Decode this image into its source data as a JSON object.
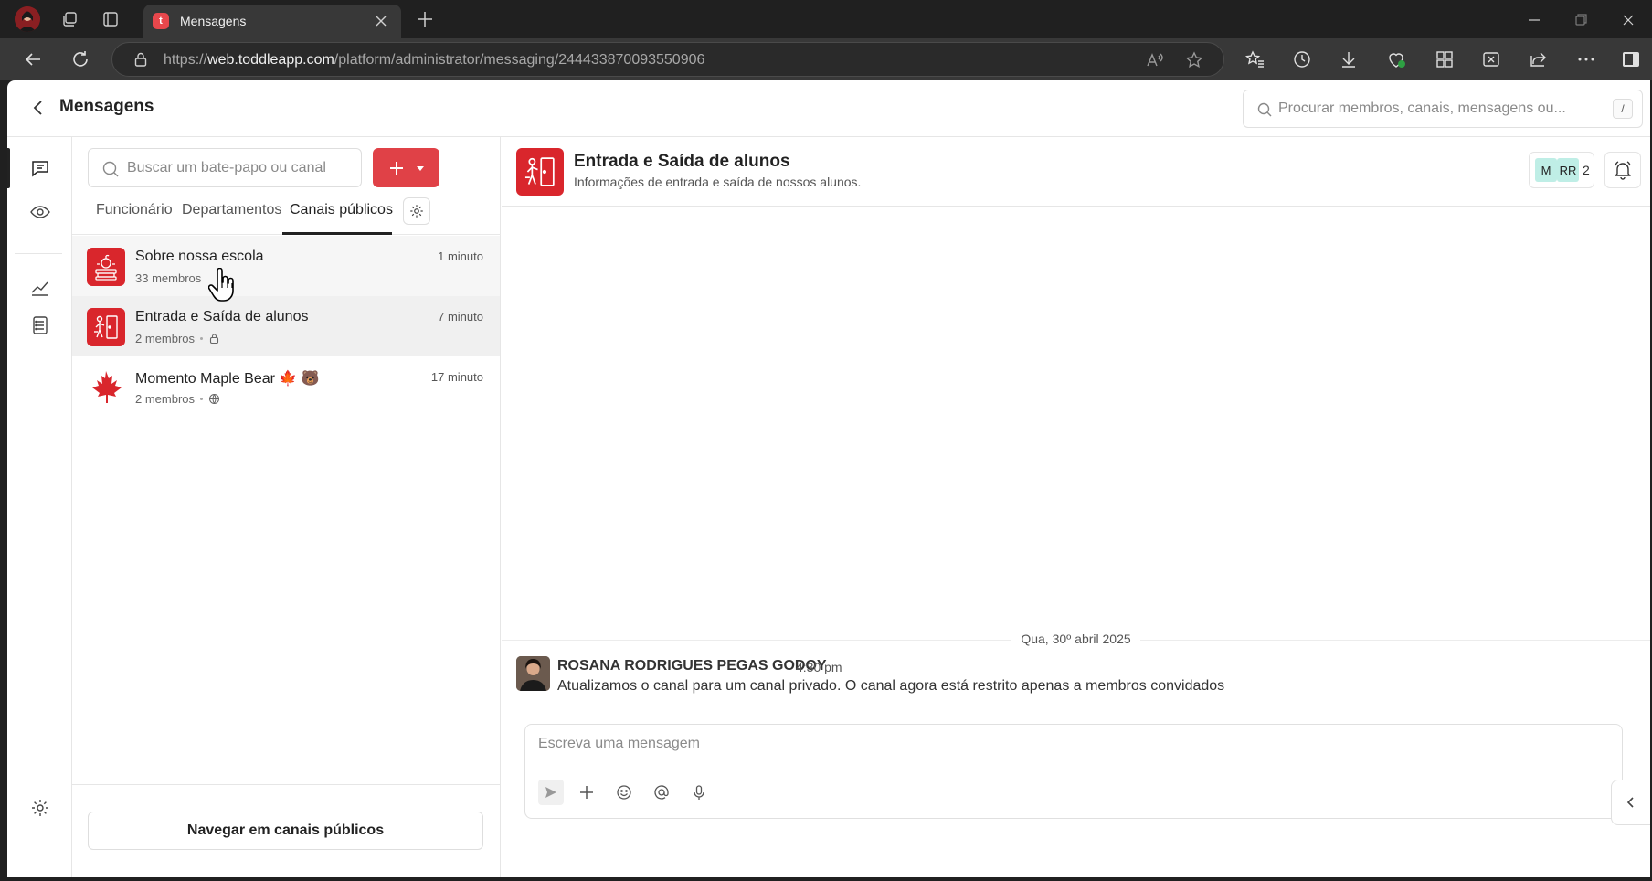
{
  "browser": {
    "tab_title": "Mensagens",
    "tab_favicon_letter": "t",
    "url_prefix": "https://",
    "url_domain": "web.toddleapp.com",
    "url_path": "/platform/administrator/messaging/244433870093550906"
  },
  "app": {
    "title": "Mensagens",
    "global_search_placeholder": "Procurar membros, canais, mensagens ou...",
    "global_search_shortcut": "/"
  },
  "rail": {
    "items": [
      {
        "icon": "chat-icon",
        "active": true
      },
      {
        "icon": "eye-icon",
        "active": false
      },
      {
        "icon": "analytics-icon",
        "active": false
      },
      {
        "icon": "list-icon",
        "active": false
      },
      {
        "icon": "gear-icon",
        "active": false
      }
    ]
  },
  "list": {
    "search_placeholder": "Buscar um bate-papo ou canal",
    "tabs": [
      {
        "label": "Funcionário",
        "active": false
      },
      {
        "label": "Departamentos",
        "active": false
      },
      {
        "label": "Canais públicos",
        "active": true
      }
    ],
    "channels": [
      {
        "name": "Sobre nossa escola",
        "members": "33 membros",
        "time": "1 minuto",
        "icon": "school-books-icon"
      },
      {
        "name": "Entrada e Saída de alunos",
        "members": "2 membros",
        "time": "7 minuto",
        "icon": "door-exit-icon",
        "visibility": "lock-icon"
      },
      {
        "name": "Momento Maple Bear 🍁 🐻",
        "members": "2 membros",
        "time": "17 minuto",
        "icon": "maple-leaf-icon",
        "visibility": "globe-icon"
      }
    ],
    "browse_label": "Navegar em canais públicos"
  },
  "chat": {
    "channel_name": "Entrada e Saída de alunos",
    "channel_desc": "Informações de entrada e saída de nossos alunos.",
    "member_chips": [
      "M",
      "RR"
    ],
    "member_count": "2",
    "date_divider": "Qua, 30º abril 2025",
    "messages": [
      {
        "author": "ROSANA RODRIGUES PEGAS GODOY",
        "time": "4:30 pm",
        "text": "Atualizamos o canal para um canal privado. O canal agora está restrito apenas a membros convidados"
      }
    ],
    "composer_placeholder": "Escreva uma mensagem"
  },
  "colors": {
    "brand_red": "#e04147",
    "channel_red": "#d9262c",
    "member_chip": "#bfeee6"
  }
}
